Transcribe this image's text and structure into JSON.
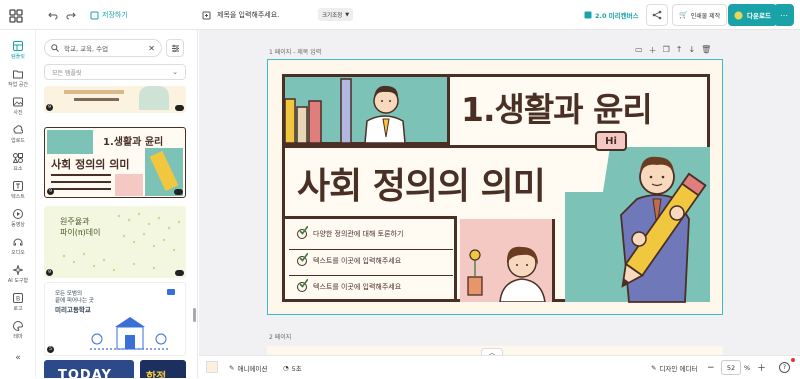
{
  "topbar": {
    "save_label": "저장하기",
    "title_placeholder": "제목을 입력해주세요.",
    "size_label": "크기조정",
    "canvas_version": "2.0 미리캔버스",
    "print_label": "인쇄물 제작",
    "download_label": "다운로드"
  },
  "leftnav": {
    "items": [
      "템플릿",
      "작업 공간",
      "사진",
      "업로드",
      "요소",
      "텍스트",
      "동영상",
      "오디오",
      "AI 도구함",
      "로고",
      "테마"
    ],
    "active": "템플릿"
  },
  "panel": {
    "search_value": "학교, 교육, 수업",
    "category_placeholder": "모든 템플릿",
    "thumbnails": [
      {
        "num": "9",
        "caption": ""
      },
      {
        "num": "9",
        "caption": "1.생활과 윤리"
      },
      {
        "num": "9",
        "caption": "사회 정의의 의미"
      },
      {
        "num": "9",
        "caption": "원주율과 파이(π)데이"
      },
      {
        "num": "5",
        "caption": "모든 모범의 끝에 피어나는 곳 미리고등학교"
      },
      {
        "num": "",
        "caption": "TODAY"
      }
    ],
    "thumb3_line1": "원주율과",
    "thumb3_line2": "파이(π)데이",
    "thumb4_line1": "모든 모범의",
    "thumb4_line2": "끝에 피어나는 곳",
    "thumb4_line3": "미리고등학교",
    "thumb2_t1": "1.생활과 윤리",
    "thumb2_t2": "사회 정의의 의미",
    "thumb5_text": "TODAY",
    "thumb6_text": "한정"
  },
  "canvas": {
    "page1_label": "1 페이지 - 제목 입력",
    "page2_label": "2 페이지",
    "title_line1": "1.생활과 윤리",
    "title_line2": "사회 정의의 의미",
    "speech_bubble": "Hi",
    "bullets": [
      "다양한 정의관에 대해 토론하기",
      "텍스트를 이곳에 입력해주세요",
      "텍스트를 이곳에 입력해주세요"
    ]
  },
  "bottombar": {
    "animation_label": "애니메이션",
    "duration_label": "5초",
    "design_editor_label": "디자인 에디터",
    "zoom_value": "52",
    "zoom_unit": "%"
  },
  "colors": {
    "accent": "#19a3a8",
    "brown": "#4a2f25",
    "teal_bg": "#7cc2b6",
    "pink": "#f4c9c4"
  }
}
